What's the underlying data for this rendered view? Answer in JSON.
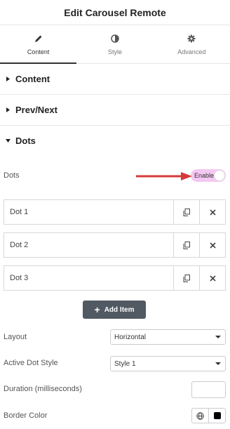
{
  "panel": {
    "title": "Edit Carousel Remote"
  },
  "tabs": [
    {
      "label": "Content",
      "icon": "pencil-icon"
    },
    {
      "label": "Style",
      "icon": "contrast-icon"
    },
    {
      "label": "Advanced",
      "icon": "gear-icon"
    }
  ],
  "sections": [
    {
      "label": "Content"
    },
    {
      "label": "Prev/Next"
    },
    {
      "label": "Dots"
    }
  ],
  "dots": {
    "label": "Dots",
    "toggle_label": "Enable",
    "toggle_color": "#f4c8f2",
    "annotation_color": "#d63a3a"
  },
  "items": [
    {
      "title": "Dot 1"
    },
    {
      "title": "Dot 2"
    },
    {
      "title": "Dot 3"
    }
  ],
  "add_item_label": "Add Item",
  "layout": {
    "label": "Layout",
    "value": "Horizontal"
  },
  "active_dot_style": {
    "label": "Active Dot Style",
    "value": "Style 1"
  },
  "duration": {
    "label": "Duration (milliseconds)",
    "value": ""
  },
  "border_color": {
    "label": "Border Color",
    "swatch": "#000000"
  }
}
